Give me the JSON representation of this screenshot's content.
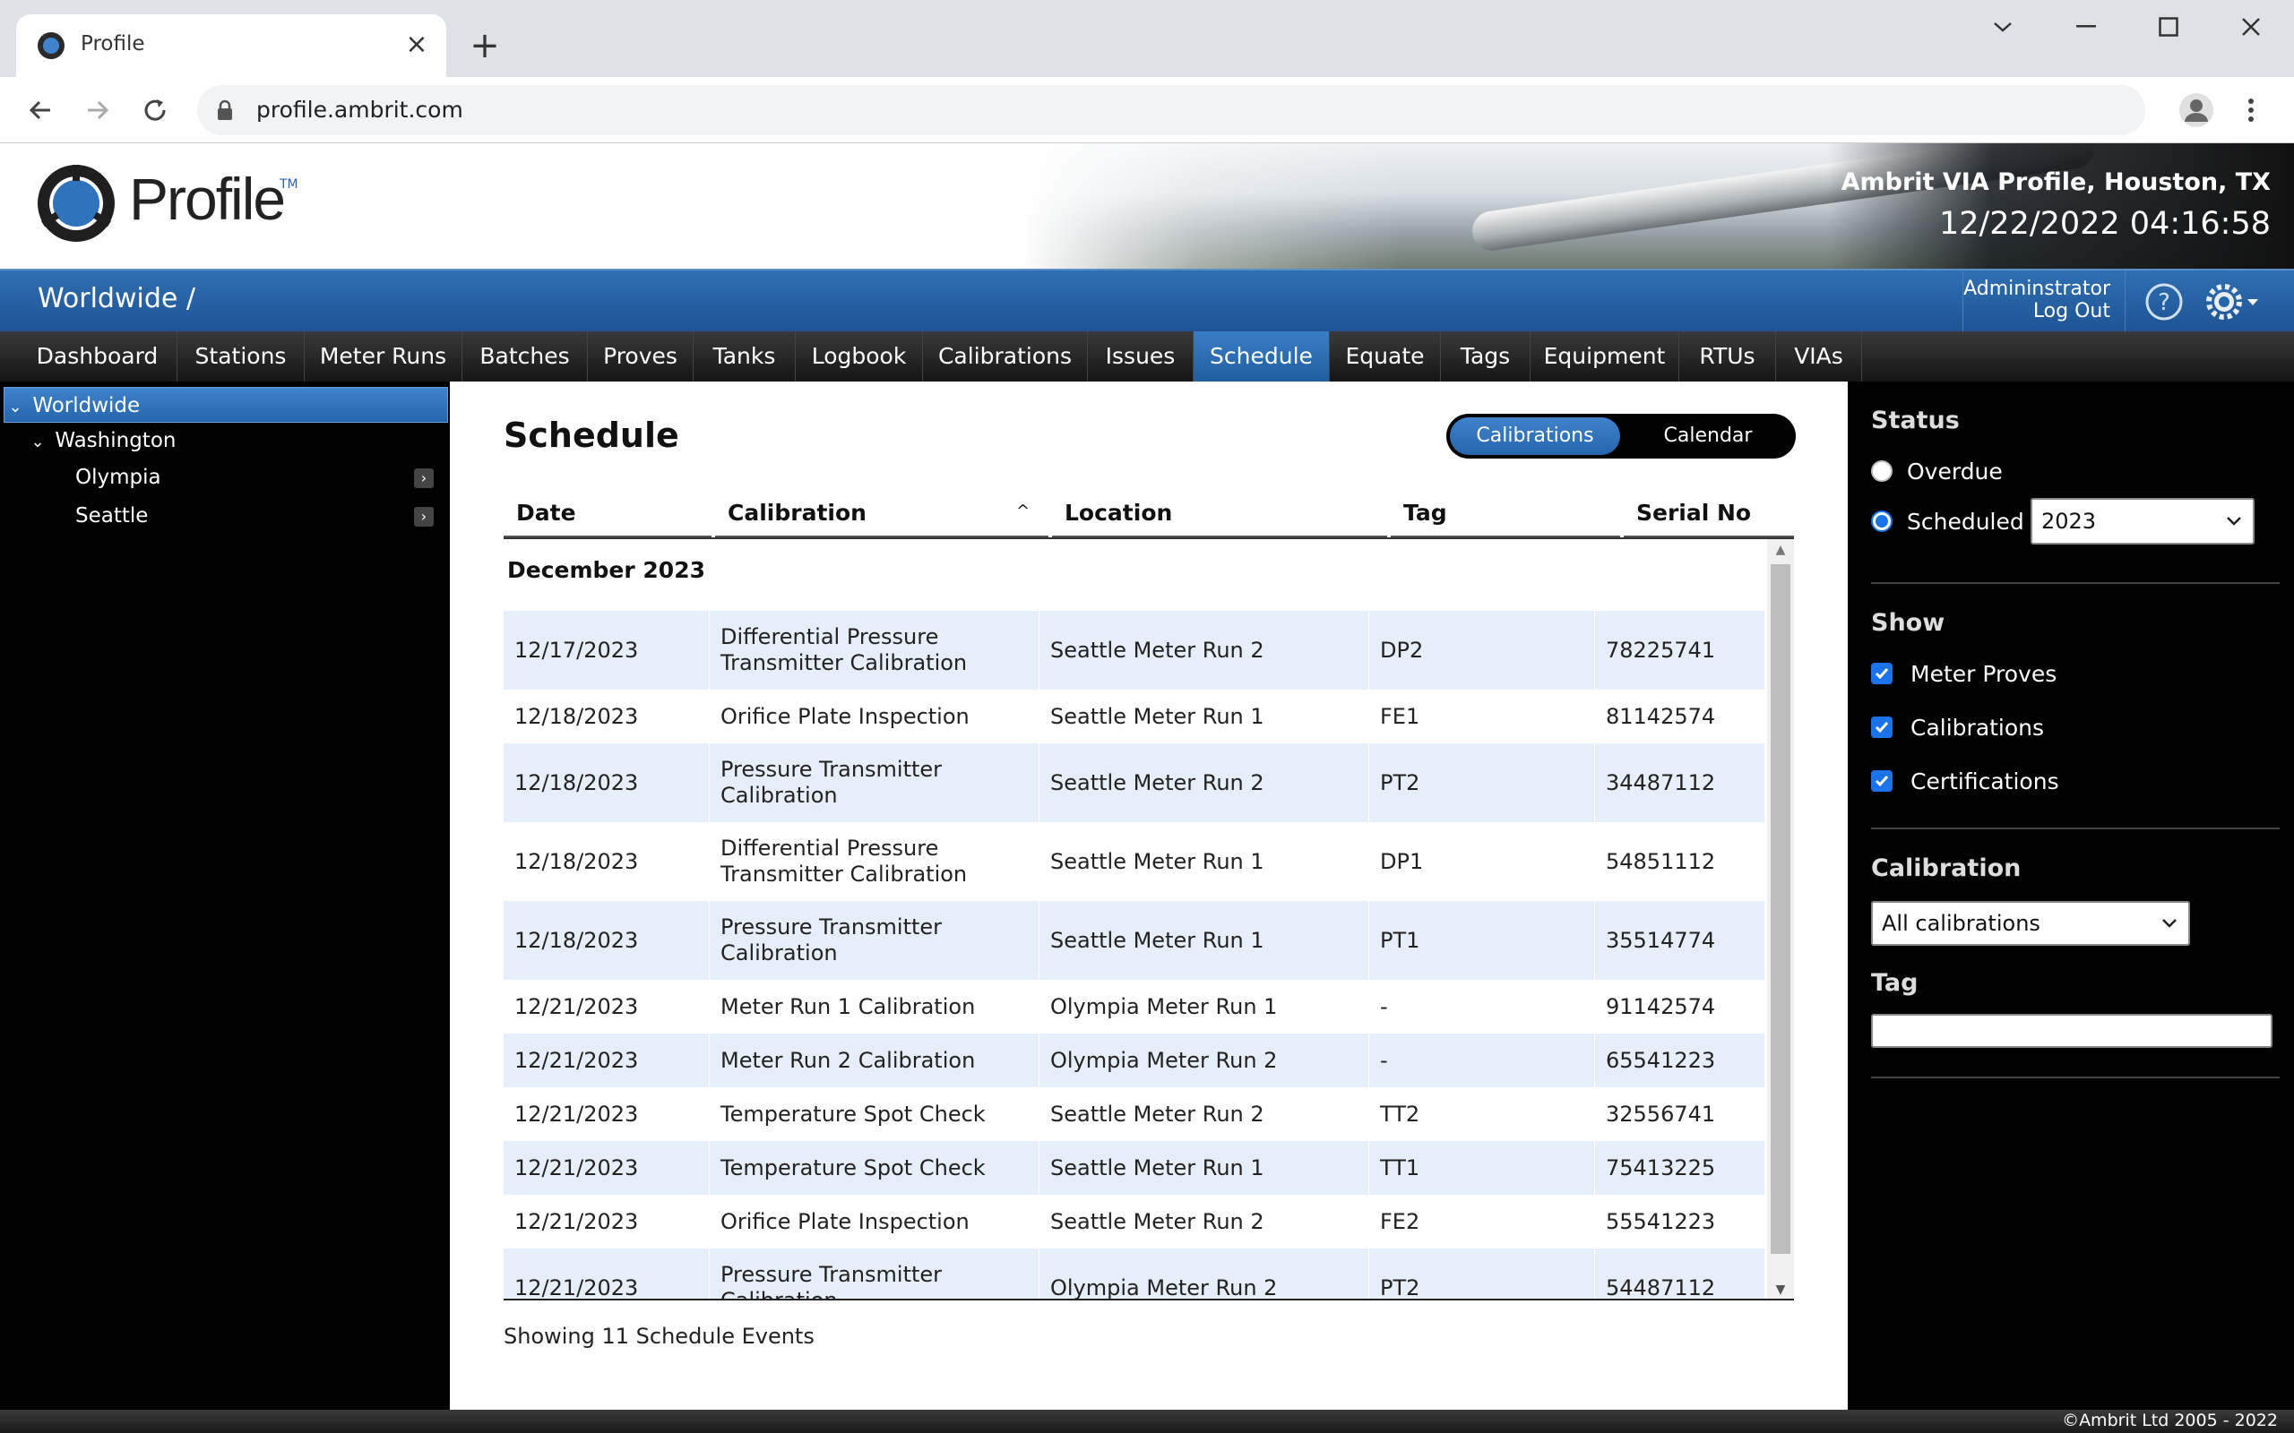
{
  "browser": {
    "tab_title": "Profile",
    "url": "profile.ambrit.com"
  },
  "header": {
    "logo_text": "Profile",
    "logo_tm": "TM",
    "site_name": "Ambrit VIA Profile, Houston, TX",
    "clock": "12/22/2022 04:16:58"
  },
  "bluebar": {
    "breadcrumb": "Worldwide /",
    "user_name": "Admininstrator",
    "logout": "Log Out"
  },
  "menu": [
    {
      "label": "Dashboard"
    },
    {
      "label": "Stations"
    },
    {
      "label": "Meter Runs"
    },
    {
      "label": "Batches"
    },
    {
      "label": "Proves"
    },
    {
      "label": "Tanks"
    },
    {
      "label": "Logbook"
    },
    {
      "label": "Calibrations"
    },
    {
      "label": "Issues"
    },
    {
      "label": "Schedule"
    },
    {
      "label": "Equate"
    },
    {
      "label": "Tags"
    },
    {
      "label": "Equipment"
    },
    {
      "label": "RTUs"
    },
    {
      "label": "VIAs"
    }
  ],
  "tree": {
    "root": "Worldwide",
    "region": "Washington",
    "stations": [
      "Olympia",
      "Seattle"
    ]
  },
  "main": {
    "title": "Schedule",
    "toggle": {
      "calibrations": "Calibrations",
      "calendar": "Calendar"
    },
    "columns": [
      "Date",
      "Calibration",
      "Location",
      "Tag",
      "Serial No"
    ],
    "group": "December 2023",
    "rows": [
      {
        "date": "12/17/2023",
        "calibration": "Differential Pressure Transmitter Calibration",
        "location": "Seattle Meter Run 2",
        "tag": "DP2",
        "serial": "78225741"
      },
      {
        "date": "12/18/2023",
        "calibration": "Orifice Plate Inspection",
        "location": "Seattle Meter Run 1",
        "tag": "FE1",
        "serial": "81142574"
      },
      {
        "date": "12/18/2023",
        "calibration": "Pressure Transmitter Calibration",
        "location": "Seattle Meter Run 2",
        "tag": "PT2",
        "serial": "34487112"
      },
      {
        "date": "12/18/2023",
        "calibration": "Differential Pressure Transmitter Calibration",
        "location": "Seattle Meter Run 1",
        "tag": "DP1",
        "serial": "54851112"
      },
      {
        "date": "12/18/2023",
        "calibration": "Pressure Transmitter Calibration",
        "location": "Seattle Meter Run 1",
        "tag": "PT1",
        "serial": "35514774"
      },
      {
        "date": "12/21/2023",
        "calibration": "Meter Run 1 Calibration",
        "location": "Olympia Meter Run 1",
        "tag": "-",
        "serial": "91142574"
      },
      {
        "date": "12/21/2023",
        "calibration": "Meter Run 2 Calibration",
        "location": "Olympia Meter Run 2",
        "tag": "-",
        "serial": "65541223"
      },
      {
        "date": "12/21/2023",
        "calibration": "Temperature Spot Check",
        "location": "Seattle Meter Run 2",
        "tag": "TT2",
        "serial": "32556741"
      },
      {
        "date": "12/21/2023",
        "calibration": "Temperature Spot Check",
        "location": "Seattle Meter Run 1",
        "tag": "TT1",
        "serial": "75413225"
      },
      {
        "date": "12/21/2023",
        "calibration": "Orifice Plate Inspection",
        "location": "Seattle Meter Run 2",
        "tag": "FE2",
        "serial": "55541223"
      },
      {
        "date": "12/21/2023",
        "calibration": "Pressure Transmitter Calibration",
        "location": "Olympia Meter Run 2",
        "tag": "PT2",
        "serial": "54487112"
      }
    ],
    "footer": "Showing 11 Schedule Events"
  },
  "filters": {
    "status_heading": "Status",
    "overdue": "Overdue",
    "scheduled": "Scheduled",
    "year": "2023",
    "show_heading": "Show",
    "show_items": [
      "Meter Proves",
      "Calibrations",
      "Certifications"
    ],
    "calibration_heading": "Calibration",
    "calibration_select": "All calibrations",
    "tag_heading": "Tag",
    "tag_value": ""
  },
  "copyright": "©Ambrit Ltd 2005 - 2022",
  "colors": {
    "accent": "#2566ad",
    "row_shade": "#e6eefa",
    "checkbox": "#1a73e8"
  }
}
